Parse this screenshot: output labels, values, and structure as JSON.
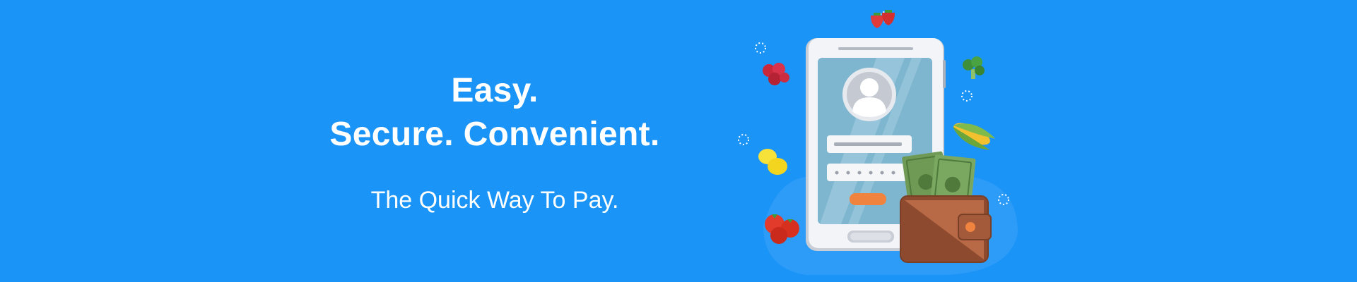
{
  "headline": {
    "line1": "Easy.",
    "line2": "Secure. Convenient."
  },
  "tagline": "The Quick Way To Pay.",
  "illustration": {
    "icons": [
      "smartphone-icon",
      "user-avatar-icon",
      "wallet-icon",
      "banknote-icon",
      "strawberry-icon",
      "broccoli-icon",
      "corn-icon",
      "lemon-icon",
      "tomato-icon",
      "sparkle-icon"
    ]
  },
  "colors": {
    "background": "#1b94f8",
    "text": "#ffffff",
    "phone_screen": "#7fb6cf",
    "wallet": "#a35a3a",
    "button_accent": "#f0843e",
    "money": "#6e9a55"
  }
}
